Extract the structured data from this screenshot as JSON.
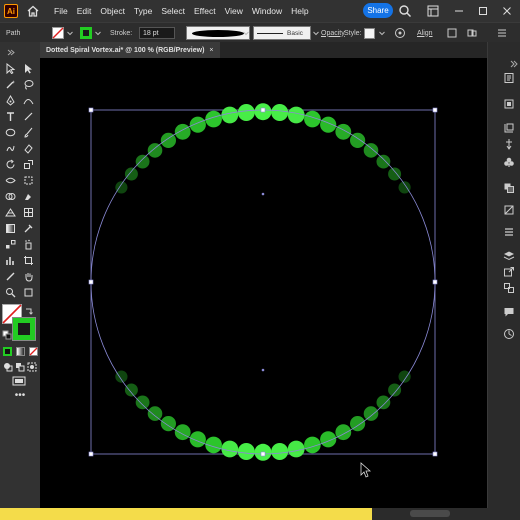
{
  "app": {
    "logo": "Ai",
    "menus": [
      "File",
      "Edit",
      "Object",
      "Type",
      "Select",
      "Effect",
      "View",
      "Window",
      "Help"
    ],
    "share_label": "Share"
  },
  "control_bar": {
    "selection_label": "Path",
    "stroke_label": "Stroke:",
    "stroke_value": "18 pt",
    "profile_label": "Basic",
    "opacity_label": "Opacity",
    "style_label": "Style:",
    "align_label": "Align"
  },
  "document": {
    "tab_title": "Dotted Spiral Vortex.ai* @ 100 % (RGB/Preview)",
    "close_glyph": "×"
  },
  "artwork": {
    "background": "#000000",
    "dot_color": "#2fd12f",
    "dot_bright_color": "#48f048",
    "guide_color": "#8a8ad6"
  },
  "colors": {
    "menubar": "#323232",
    "accent": "#1473e6",
    "fill_swatch": "#22cc22"
  }
}
